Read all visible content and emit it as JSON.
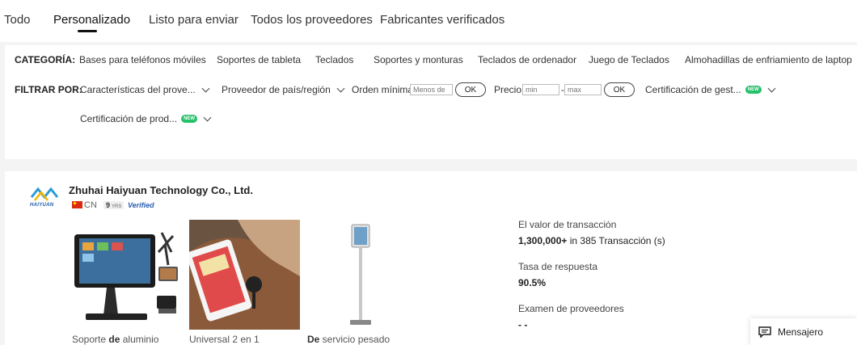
{
  "tabs": [
    "Todo",
    "Personalizado",
    "Listo para enviar",
    "Todos los proveedores",
    "Fabricantes verificados"
  ],
  "filters": {
    "category_label": "CATEGORÍA:",
    "categories": [
      "Bases para teléfonos móviles",
      "Soportes de tableta",
      "Teclados",
      "Soportes y monturas",
      "Teclados de ordenador",
      "Juego de Teclados",
      "Almohadillas de enfriamiento de laptop"
    ],
    "filter_label": "FILTRAR POR:",
    "dropdowns": [
      "Características del prove...",
      "Proveedor de país/región",
      "Certificación de gest...",
      "Certificación de prod..."
    ],
    "new_badge": "NEW",
    "min_order_label": "Orden mínima:",
    "min_order_placeholder": "Menos de",
    "price_label": "Precio:",
    "price_min_placeholder": "min",
    "price_max_placeholder": "max",
    "price_separator": "-",
    "ok_label": "OK"
  },
  "supplier": {
    "logo_text": "HAIYUAN",
    "name": "Zhuhai Haiyuan Technology Co., Ltd.",
    "country": "CN",
    "years": "9",
    "years_suffix": "YRS",
    "verified": "Verified",
    "products": [
      {
        "pre": "Soporte ",
        "bold": "de",
        "post": " aluminio"
      },
      {
        "pre": "Universal 2 en 1",
        "bold": "",
        "post": ""
      },
      {
        "pre": "",
        "bold": "De",
        "post": " servicio pesado"
      }
    ],
    "stats": {
      "transaction_label": "El valor de transacción",
      "transaction_value": "1,300,000+",
      "transaction_detail": " in 385 Transacción (s)",
      "response_label": "Tasa de respuesta",
      "response_value": "90.5%",
      "review_label": "Examen de proveedores",
      "review_value": "- -"
    }
  },
  "messenger": {
    "label": "Mensajero"
  }
}
